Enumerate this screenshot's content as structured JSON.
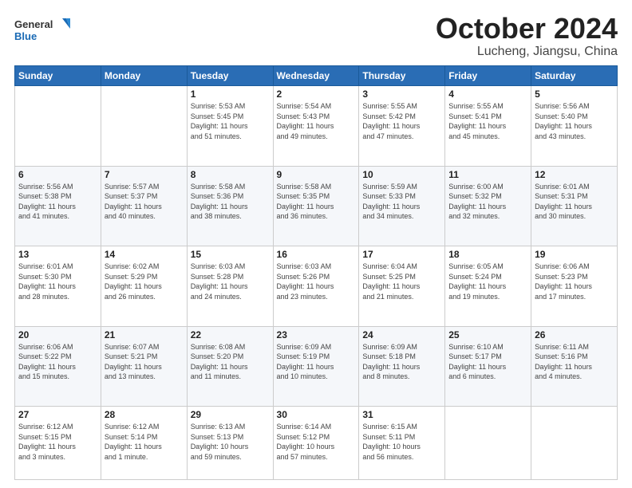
{
  "logo": {
    "line1": "General",
    "line2": "Blue"
  },
  "header": {
    "month": "October 2024",
    "location": "Lucheng, Jiangsu, China"
  },
  "weekdays": [
    "Sunday",
    "Monday",
    "Tuesday",
    "Wednesday",
    "Thursday",
    "Friday",
    "Saturday"
  ],
  "weeks": [
    [
      {
        "day": "",
        "info": ""
      },
      {
        "day": "",
        "info": ""
      },
      {
        "day": "1",
        "info": "Sunrise: 5:53 AM\nSunset: 5:45 PM\nDaylight: 11 hours\nand 51 minutes."
      },
      {
        "day": "2",
        "info": "Sunrise: 5:54 AM\nSunset: 5:43 PM\nDaylight: 11 hours\nand 49 minutes."
      },
      {
        "day": "3",
        "info": "Sunrise: 5:55 AM\nSunset: 5:42 PM\nDaylight: 11 hours\nand 47 minutes."
      },
      {
        "day": "4",
        "info": "Sunrise: 5:55 AM\nSunset: 5:41 PM\nDaylight: 11 hours\nand 45 minutes."
      },
      {
        "day": "5",
        "info": "Sunrise: 5:56 AM\nSunset: 5:40 PM\nDaylight: 11 hours\nand 43 minutes."
      }
    ],
    [
      {
        "day": "6",
        "info": "Sunrise: 5:56 AM\nSunset: 5:38 PM\nDaylight: 11 hours\nand 41 minutes."
      },
      {
        "day": "7",
        "info": "Sunrise: 5:57 AM\nSunset: 5:37 PM\nDaylight: 11 hours\nand 40 minutes."
      },
      {
        "day": "8",
        "info": "Sunrise: 5:58 AM\nSunset: 5:36 PM\nDaylight: 11 hours\nand 38 minutes."
      },
      {
        "day": "9",
        "info": "Sunrise: 5:58 AM\nSunset: 5:35 PM\nDaylight: 11 hours\nand 36 minutes."
      },
      {
        "day": "10",
        "info": "Sunrise: 5:59 AM\nSunset: 5:33 PM\nDaylight: 11 hours\nand 34 minutes."
      },
      {
        "day": "11",
        "info": "Sunrise: 6:00 AM\nSunset: 5:32 PM\nDaylight: 11 hours\nand 32 minutes."
      },
      {
        "day": "12",
        "info": "Sunrise: 6:01 AM\nSunset: 5:31 PM\nDaylight: 11 hours\nand 30 minutes."
      }
    ],
    [
      {
        "day": "13",
        "info": "Sunrise: 6:01 AM\nSunset: 5:30 PM\nDaylight: 11 hours\nand 28 minutes."
      },
      {
        "day": "14",
        "info": "Sunrise: 6:02 AM\nSunset: 5:29 PM\nDaylight: 11 hours\nand 26 minutes."
      },
      {
        "day": "15",
        "info": "Sunrise: 6:03 AM\nSunset: 5:28 PM\nDaylight: 11 hours\nand 24 minutes."
      },
      {
        "day": "16",
        "info": "Sunrise: 6:03 AM\nSunset: 5:26 PM\nDaylight: 11 hours\nand 23 minutes."
      },
      {
        "day": "17",
        "info": "Sunrise: 6:04 AM\nSunset: 5:25 PM\nDaylight: 11 hours\nand 21 minutes."
      },
      {
        "day": "18",
        "info": "Sunrise: 6:05 AM\nSunset: 5:24 PM\nDaylight: 11 hours\nand 19 minutes."
      },
      {
        "day": "19",
        "info": "Sunrise: 6:06 AM\nSunset: 5:23 PM\nDaylight: 11 hours\nand 17 minutes."
      }
    ],
    [
      {
        "day": "20",
        "info": "Sunrise: 6:06 AM\nSunset: 5:22 PM\nDaylight: 11 hours\nand 15 minutes."
      },
      {
        "day": "21",
        "info": "Sunrise: 6:07 AM\nSunset: 5:21 PM\nDaylight: 11 hours\nand 13 minutes."
      },
      {
        "day": "22",
        "info": "Sunrise: 6:08 AM\nSunset: 5:20 PM\nDaylight: 11 hours\nand 11 minutes."
      },
      {
        "day": "23",
        "info": "Sunrise: 6:09 AM\nSunset: 5:19 PM\nDaylight: 11 hours\nand 10 minutes."
      },
      {
        "day": "24",
        "info": "Sunrise: 6:09 AM\nSunset: 5:18 PM\nDaylight: 11 hours\nand 8 minutes."
      },
      {
        "day": "25",
        "info": "Sunrise: 6:10 AM\nSunset: 5:17 PM\nDaylight: 11 hours\nand 6 minutes."
      },
      {
        "day": "26",
        "info": "Sunrise: 6:11 AM\nSunset: 5:16 PM\nDaylight: 11 hours\nand 4 minutes."
      }
    ],
    [
      {
        "day": "27",
        "info": "Sunrise: 6:12 AM\nSunset: 5:15 PM\nDaylight: 11 hours\nand 3 minutes."
      },
      {
        "day": "28",
        "info": "Sunrise: 6:12 AM\nSunset: 5:14 PM\nDaylight: 11 hours\nand 1 minute."
      },
      {
        "day": "29",
        "info": "Sunrise: 6:13 AM\nSunset: 5:13 PM\nDaylight: 10 hours\nand 59 minutes."
      },
      {
        "day": "30",
        "info": "Sunrise: 6:14 AM\nSunset: 5:12 PM\nDaylight: 10 hours\nand 57 minutes."
      },
      {
        "day": "31",
        "info": "Sunrise: 6:15 AM\nSunset: 5:11 PM\nDaylight: 10 hours\nand 56 minutes."
      },
      {
        "day": "",
        "info": ""
      },
      {
        "day": "",
        "info": ""
      }
    ]
  ]
}
